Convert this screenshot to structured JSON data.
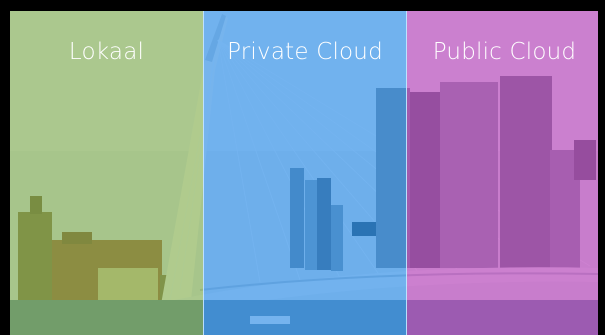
{
  "panels": [
    {
      "label": "Lokaal",
      "tint": "#78aa3c"
    },
    {
      "label": "Private Cloud",
      "tint": "#288ceb"
    },
    {
      "label": "Public Cloud",
      "tint": "#b93cb9"
    }
  ],
  "scene": {
    "subject": "city-skyline-cable-stayed-bridge",
    "sky_color": "#dfe8ee",
    "water_color": "#5a7f95"
  }
}
